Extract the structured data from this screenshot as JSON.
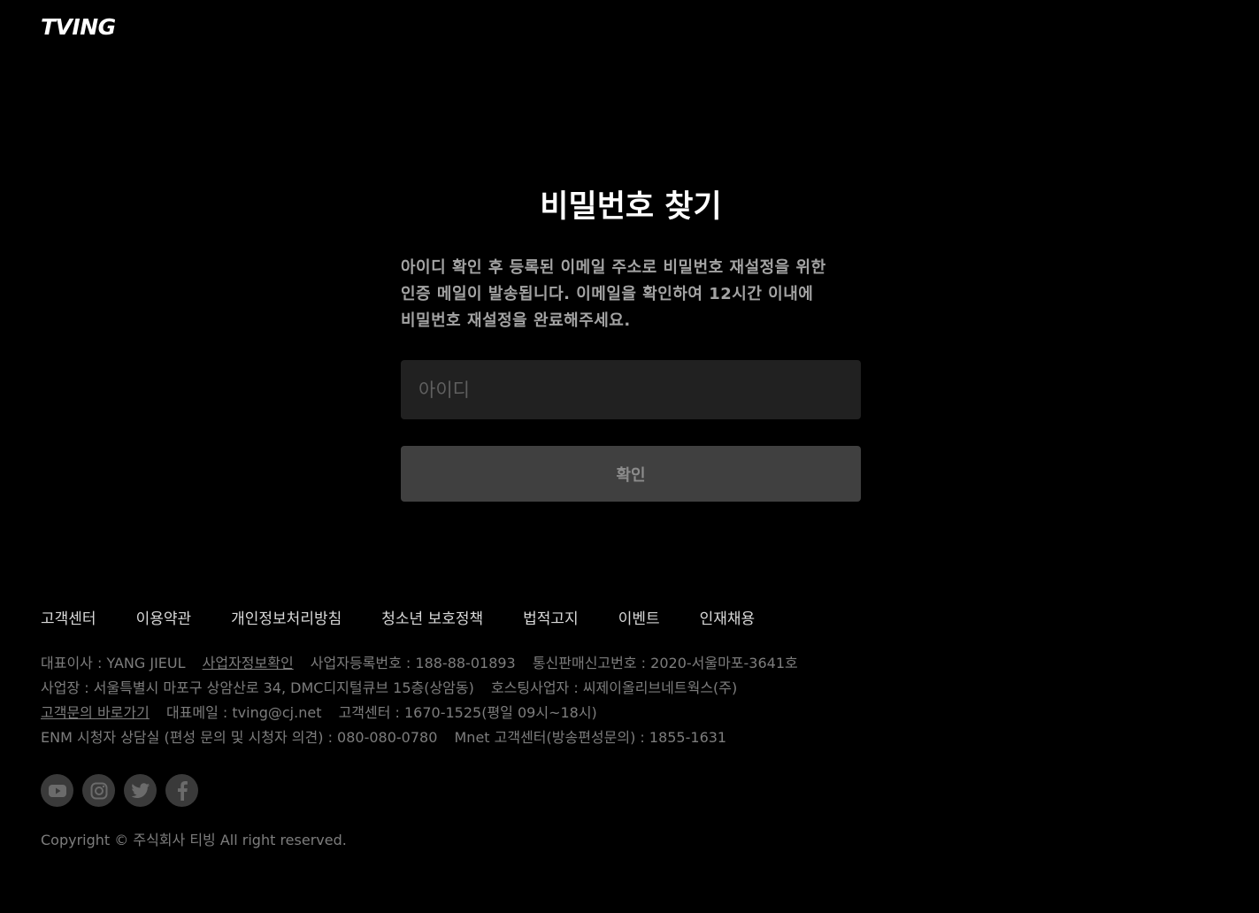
{
  "header": {
    "logo_text": "TVING"
  },
  "main": {
    "title": "비밀번호 찾기",
    "description": "아이디 확인 후 등록된 이메일 주소로 비밀번호 재설정을 위한 인증 메일이 발송됩니다. 이메일을 확인하여 12시간 이내에 비밀번호 재설정을 완료해주세요.",
    "id_input": {
      "placeholder": "아이디",
      "value": ""
    },
    "confirm_label": "확인"
  },
  "footer": {
    "nav": [
      "고객센터",
      "이용약관",
      "개인정보처리방침",
      "청소년 보호정책",
      "법적고지",
      "이벤트",
      "인재채용"
    ],
    "info": {
      "line1": {
        "ceo": "대표이사 : YANG JIEUL",
        "biz_info_link": "사업자정보확인",
        "reg_no": "사업자등록번호 : 188-88-01893",
        "mail_order": "통신판매신고번호 : 2020-서울마포-3641호"
      },
      "line2": {
        "address": "사업장 : 서울특별시 마포구 상암산로 34, DMC디지털큐브 15층(상암동)",
        "hosting": "호스팅사업자 : 씨제이올리브네트웍스(주)"
      },
      "line3": {
        "inquiry_link": "고객문의 바로가기",
        "email": "대표메일 : tving@cj.net",
        "center": "고객센터 : 1670-1525(평일 09시~18시)"
      },
      "line4": {
        "enm": "ENM 시청자 상담실 (편성 문의 및 시청자 의견) : 080-080-0780",
        "mnet": "Mnet 고객센터(방송편성문의) : 1855-1631"
      }
    },
    "social_icons": [
      "youtube-icon",
      "instagram-icon",
      "twitter-icon",
      "facebook-icon"
    ],
    "copyright": "Copyright © 주식회사 티빙 All right reserved."
  },
  "colors": {
    "background": "#000000",
    "input_bg": "#212121",
    "button_bg": "#404040",
    "desc_text": "#a3a3a3",
    "footer_text": "#7d7d7d"
  }
}
